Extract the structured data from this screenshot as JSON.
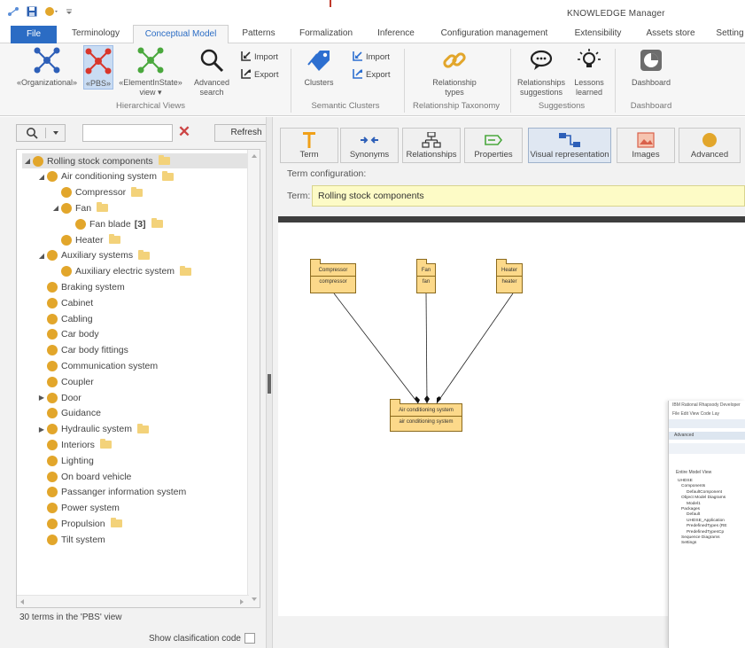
{
  "window": {
    "title": "KNOWLEDGE Manager"
  },
  "tabs": [
    {
      "label": "File"
    },
    {
      "label": "Terminology"
    },
    {
      "label": "Conceptual Model"
    },
    {
      "label": "Patterns"
    },
    {
      "label": "Formalization"
    },
    {
      "label": "Inference"
    },
    {
      "label": "Configuration management"
    },
    {
      "label": "Extensibility"
    },
    {
      "label": "Assets store"
    },
    {
      "label": "Setting"
    }
  ],
  "ribbon": {
    "hierarchical": {
      "organizational": "«Organizational»",
      "pbs": "«PBS»",
      "element_in_state_1": "«ElementInState»",
      "element_in_state_2": "view ▾",
      "advanced_search_1": "Advanced",
      "advanced_search_2": "search",
      "import": "Import",
      "export": "Export",
      "group": "Hierarchical Views"
    },
    "semantic": {
      "clusters": "Clusters",
      "import": "Import",
      "export": "Export",
      "group": "Semantic Clusters"
    },
    "taxonomy": {
      "relationship_types_1": "Relationship",
      "relationship_types_2": "types",
      "group": "Relationship Taxonomy"
    },
    "suggestions": {
      "rel_sugg_1": "Relationships",
      "rel_sugg_2": "suggestions",
      "lessons_1": "Lessons",
      "lessons_2": "learned",
      "group": "Suggestions"
    },
    "dashboard": {
      "label": "Dashboard",
      "group": "Dashboard"
    }
  },
  "left": {
    "refresh": "Refresh",
    "search_value": "",
    "tree": [
      {
        "label": "Rolling stock components",
        "level": 0,
        "expander": "◢",
        "folder": true,
        "selected": true
      },
      {
        "label": "Air conditioning system",
        "level": 1,
        "expander": "◢",
        "folder": true
      },
      {
        "label": "Compressor",
        "level": 2,
        "expander": "",
        "folder": true
      },
      {
        "label": "Fan",
        "level": 2,
        "expander": "◢",
        "folder": true
      },
      {
        "label": "Fan blade",
        "level": 3,
        "expander": "",
        "folder": true,
        "badge": "[3]"
      },
      {
        "label": "Heater",
        "level": 2,
        "expander": "",
        "folder": true
      },
      {
        "label": "Auxiliary systems",
        "level": 1,
        "expander": "◢",
        "folder": true
      },
      {
        "label": "Auxiliary electric system",
        "level": 2,
        "expander": "",
        "folder": true
      },
      {
        "label": "Braking system",
        "level": 1,
        "expander": "",
        "folder": false
      },
      {
        "label": "Cabinet",
        "level": 1,
        "expander": "",
        "folder": false
      },
      {
        "label": "Cabling",
        "level": 1,
        "expander": "",
        "folder": false
      },
      {
        "label": "Car body",
        "level": 1,
        "expander": "",
        "folder": false
      },
      {
        "label": "Car body fittings",
        "level": 1,
        "expander": "",
        "folder": false
      },
      {
        "label": "Communication system",
        "level": 1,
        "expander": "",
        "folder": false
      },
      {
        "label": "Coupler",
        "level": 1,
        "expander": "",
        "folder": false
      },
      {
        "label": "Door",
        "level": 1,
        "expander": "▶",
        "folder": false
      },
      {
        "label": "Guidance",
        "level": 1,
        "expander": "",
        "folder": false
      },
      {
        "label": "Hydraulic system",
        "level": 1,
        "expander": "▶",
        "folder": true
      },
      {
        "label": "Interiors",
        "level": 1,
        "expander": "",
        "folder": true
      },
      {
        "label": "Lighting",
        "level": 1,
        "expander": "",
        "folder": false
      },
      {
        "label": "On board vehicle",
        "level": 1,
        "expander": "",
        "folder": false
      },
      {
        "label": "Passanger information system",
        "level": 1,
        "expander": "",
        "folder": false
      },
      {
        "label": "Power system",
        "level": 1,
        "expander": "",
        "folder": false
      },
      {
        "label": "Propulsion",
        "level": 1,
        "expander": "",
        "folder": true
      },
      {
        "label": "Tilt system",
        "level": 1,
        "expander": "",
        "folder": false
      }
    ],
    "status": "30 terms in the 'PBS' view",
    "show_code": "Show clasification code"
  },
  "right": {
    "tools": [
      {
        "label": "Term",
        "icon": "term-icon",
        "active": false
      },
      {
        "label": "Synonyms",
        "icon": "synonyms-icon",
        "active": false
      },
      {
        "label": "Relationships",
        "icon": "relationships-icon",
        "active": false
      },
      {
        "label": "Properties",
        "icon": "properties-icon",
        "active": false
      },
      {
        "label": "Visual representation",
        "icon": "visual-representation-icon",
        "active": true
      },
      {
        "label": "Images",
        "icon": "images-icon",
        "active": false
      },
      {
        "label": "Advanced",
        "icon": "advanced-icon",
        "active": false
      }
    ],
    "term_config_label": "Term configuration:",
    "term_label": "Term:",
    "term_value": "Rolling stock components"
  },
  "diagram": {
    "nodes": {
      "compressor": {
        "name": "Compressor",
        "value": "compressor"
      },
      "fan": {
        "name": "Fan",
        "value": "fan"
      },
      "heater": {
        "name": "Heater",
        "value": "heater"
      },
      "air_conditioning": {
        "name": "Air conditioning system",
        "value": "air conditioning system"
      }
    }
  },
  "rhapsody": {
    "title": "IBM Rational Rhapsody Developer",
    "menu": "File  Edit  View  Code  Lay",
    "tab": "Advanced",
    "combo": "Entire Model View",
    "items": [
      "UHDSE",
      "Components",
      "DefaultComponent",
      "Object Model Diagrams",
      "Model1",
      "Packages",
      "Default",
      "UHDSE_Application",
      "PredefinedTypes (RE",
      "PredefinedTypesCp",
      "Sequence Diagrams",
      "Settings"
    ]
  },
  "colors": {
    "accent": "#2b6cc4",
    "node_fill": "#fcd98a",
    "term_dot": "#e2a62b",
    "term_input": "#fdfbc6"
  }
}
